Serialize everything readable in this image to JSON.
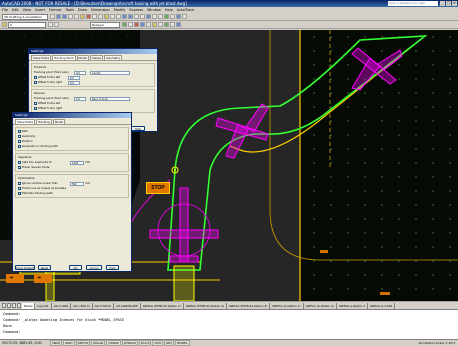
{
  "window": {
    "title": "AutoCAD 2008 - NOT FOR RESALE - [D:\\Benutzer\\Drawing\\Aircraft taxiing with jet blast.dwg]",
    "search_placeholder": "Type a question for help",
    "buttons": [
      "_",
      "□",
      "×"
    ]
  },
  "menu": [
    "File",
    "Edit",
    "View",
    "Insert",
    "Format",
    "Tools",
    "Draw",
    "Dimension",
    "Modify",
    "Express",
    "Window",
    "Help",
    "AutoTrack"
  ],
  "toolbar": {
    "workspace": "2D Drafting & Annotation",
    "layer": "0",
    "color": "ByLayer"
  },
  "tabs": {
    "items": [
      "Model",
      "Layout1",
      "A0-1:1000",
      "A0-1:500 a)",
      "A0-1:500 b)",
      "A0 LANDSCAPE",
      "GB/FAA (ESTB-42-Option 1)",
      "GB/FAA (ESTB-42-Option 2)",
      "GB/FAA (ESTB-42-Option 3)",
      "GB/FAA (A-Option 1)",
      "GB/FAA (A-Option 2)",
      "GB/FAA A-Option 3",
      "GB/FAA A-1:500"
    ],
    "active": 0
  },
  "command": {
    "lines": [
      "Command:",
      "Command: _plotgs Updating Indexes for block *MODEL_SPACE",
      "Done.",
      "Command:"
    ]
  },
  "status": {
    "coords": "59172.59, 4881.63, 0.00",
    "modes": [
      "SNAP",
      "GRID",
      "ORTHO",
      "POLAR",
      "OSNAP",
      "OTRACK",
      "DUCS",
      "DYN",
      "LWT",
      "MODEL"
    ],
    "right": "Annotation Scale: 1:40 ▾"
  },
  "dialog_main": {
    "title": "Settings",
    "tabs": [
      "Show Mode",
      "Tracking Point",
      "Model",
      "Sweep",
      "Geometry"
    ],
    "forward_label": "Forwards",
    "tracking_label": "Tracking point (front axle)",
    "offset_label": "Offset",
    "zero": "0.0",
    "combo_value": "Centre",
    "to_left": "Offset to the left",
    "to_right": "Offset to the right",
    "reverse_label": "Reverse",
    "combo_value2": "Rear of body",
    "buttons": [
      "Show Default",
      "Reset",
      "OK",
      "Cancel",
      "Help"
    ]
  },
  "dialog_sub": {
    "title": "Settings",
    "tabs": [
      "Show Mode",
      "Tracking",
      "Model"
    ],
    "options": [
      "Path",
      "Geometry",
      "Position",
      "Generate on tracking path",
      "Segments",
      "Split into segments of",
      "Travel reverse mode",
      "Optimisation",
      "Ignore vertices closer than",
      "Follow line as closely as possible",
      "Estimate tracking path"
    ],
    "len_value": "1000",
    "len_unit": "mm",
    "dist_value": "500",
    "buttons": [
      "Show Default",
      "Reset",
      "OK",
      "Cancel",
      "Help"
    ]
  },
  "canvas": {
    "stop_label": "STOP",
    "colors": {
      "path": "#33ff33",
      "aircraft_magenta": "#ff00ff",
      "aircraft_yellow": "#ffff00",
      "taxiline": "#ffcc00",
      "apron": "#3a3a3a",
      "grass": "#1a3a1a",
      "grid": "#2e5a2e"
    }
  }
}
